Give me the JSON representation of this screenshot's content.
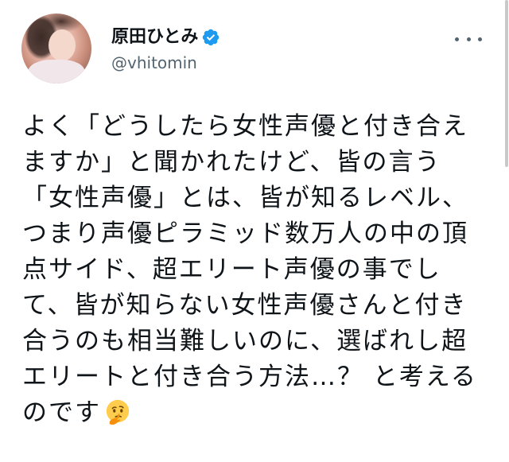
{
  "header": {
    "display_name": "原田ひとみ",
    "handle": "@vhitomin",
    "verified_icon": "verified-badge-icon",
    "more_icon": "more-options-icon"
  },
  "tweet": {
    "lines": [
      "よく「どうしたら女性声優と付き合え",
      "ますか」と聞かれたけど、皆の言う",
      "「女性声優」とは、皆が知るレベル、",
      "つまり声優ピラミッド数万人の中の頂",
      "点サイド、超エリート声優の事でし",
      "て、皆が知らない女性声優さんと付き",
      "合うのも相当難しいのに、選ばれし超",
      "エリートと付き合う方法…？ と考える",
      "のです"
    ],
    "emoji": "thinking-face-icon"
  },
  "colors": {
    "verified": "#1d9bf0",
    "handle": "#536471",
    "text": "#0f1419"
  }
}
